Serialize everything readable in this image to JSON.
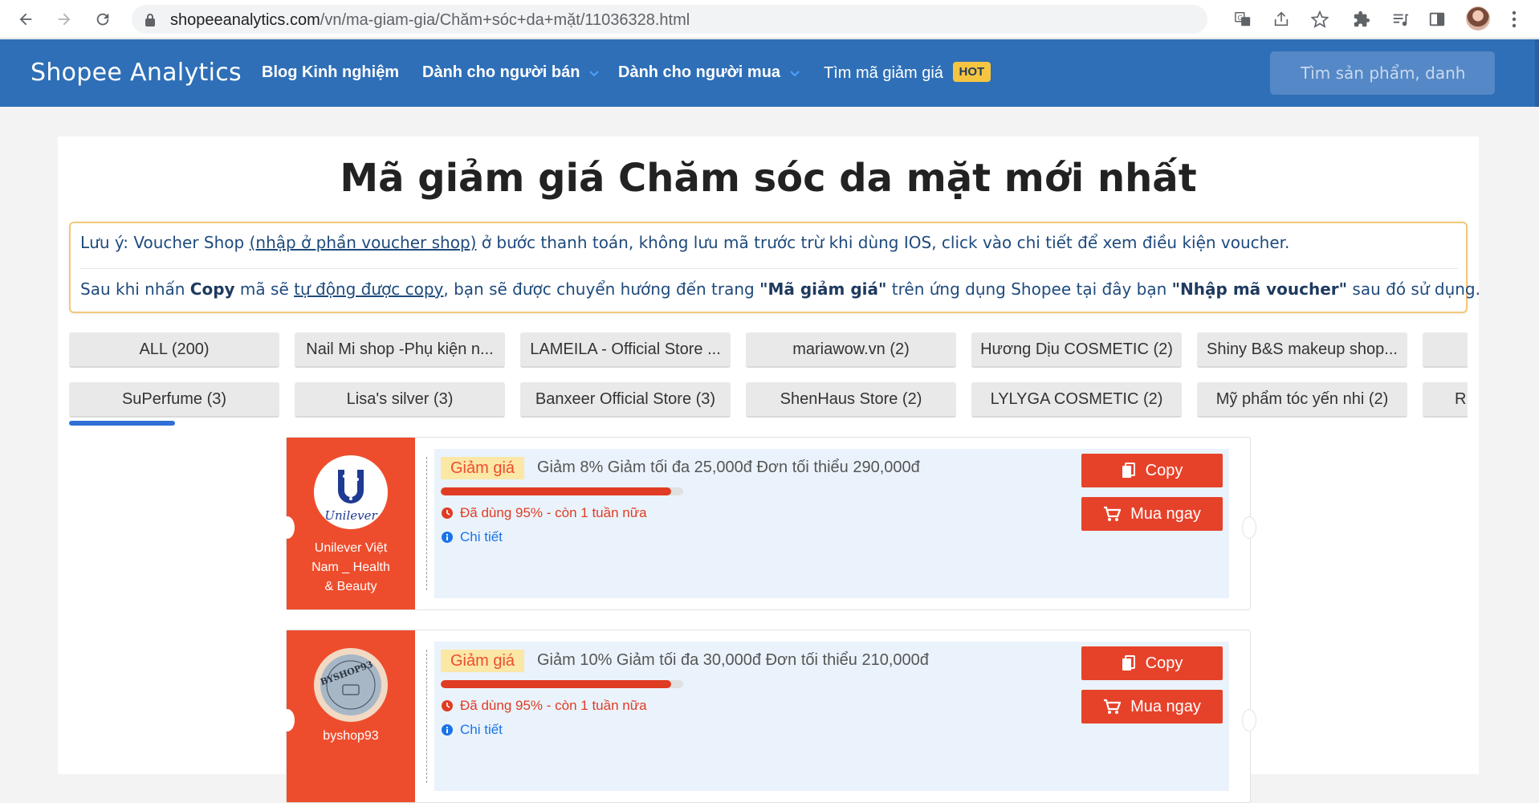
{
  "browser": {
    "url_host": "shopeeanalytics.com",
    "url_path": "/vn/ma-giam-gia/Chăm+sóc+da+mặt/11036328.html"
  },
  "header": {
    "brand": "Shopee Analytics",
    "menu": [
      {
        "label": "Blog Kinh nghiệm"
      },
      {
        "label": "Dành cho người bán"
      },
      {
        "label": "Dành cho người mua"
      },
      {
        "label": "Tìm mã giảm giá"
      }
    ],
    "hot_badge": "HOT",
    "search_placeholder": "Tìm sản phẩm, danh"
  },
  "page": {
    "title": "Mã giảm giá Chăm sóc da mặt mới nhất"
  },
  "notice": {
    "line1_prefix": "Lưu ý: Voucher Shop ",
    "line1_link": "(nhập ở phần voucher shop)",
    "line1_suffix": " ở bước thanh toán, không lưu mã trước trừ khi dùng IOS, click vào chi tiết để xem điều kiện voucher.",
    "line2_a": "Sau khi nhấn ",
    "line2_b": "Copy",
    "line2_c": " mã sẽ ",
    "line2_d": "tự động được copy",
    "line2_e": ", bạn sẽ được chuyển hướng đến trang ",
    "line2_f": "\"Mã giảm giá\"",
    "line2_g": " trên ứng dụng Shopee tại đây bạn ",
    "line2_h": "\"Nhập mã voucher\"",
    "line2_i": " sau đó sử dụng."
  },
  "tabs": {
    "row1": [
      "ALL (200)",
      "Nail Mi shop -Phụ kiện n...",
      "LAMEILA - Official Store ...",
      "mariawow.vn (2)",
      "Hương Dịu COSMETIC (2)",
      "Shiny B&S makeup shop...",
      ""
    ],
    "row2": [
      "SuPerfume (3)",
      "Lisa's silver (3)",
      "Banxeer Official Store (3)",
      "ShenHaus Store (2)",
      "LYLYGA COSMETIC (2)",
      "Mỹ phẩm tóc yến nhi (2)",
      "R"
    ]
  },
  "vouchers": [
    {
      "shop": "Unilever Việt Nam _ Health & Beauty",
      "logo_text": "Unilever",
      "badge": "Giảm giá",
      "desc": "Giảm 8% Giảm tối đa 25,000đ Đơn tối thiểu 290,000đ",
      "used_fraction": 0.95,
      "used_text": "Đã dùng 95% - còn 1 tuần nữa",
      "detail": "Chi tiết",
      "copy": "Copy",
      "buy": "Mua ngay"
    },
    {
      "shop": "byshop93",
      "logo_text": "BYSHOP93",
      "badge": "Giảm giá",
      "desc": "Giảm 10% Giảm tối đa 30,000đ Đơn tối thiểu 210,000đ",
      "used_fraction": 0.95,
      "used_text": "Đã dùng 95% - còn 1 tuần nữa",
      "detail": "Chi tiết",
      "copy": "Copy",
      "buy": "Mua ngay"
    }
  ],
  "colors": {
    "header_bg": "#2e6fb7",
    "shopee_orange": "#ee4d2d",
    "hot": "#f5c542",
    "tab_active": "#2f6fd6"
  }
}
